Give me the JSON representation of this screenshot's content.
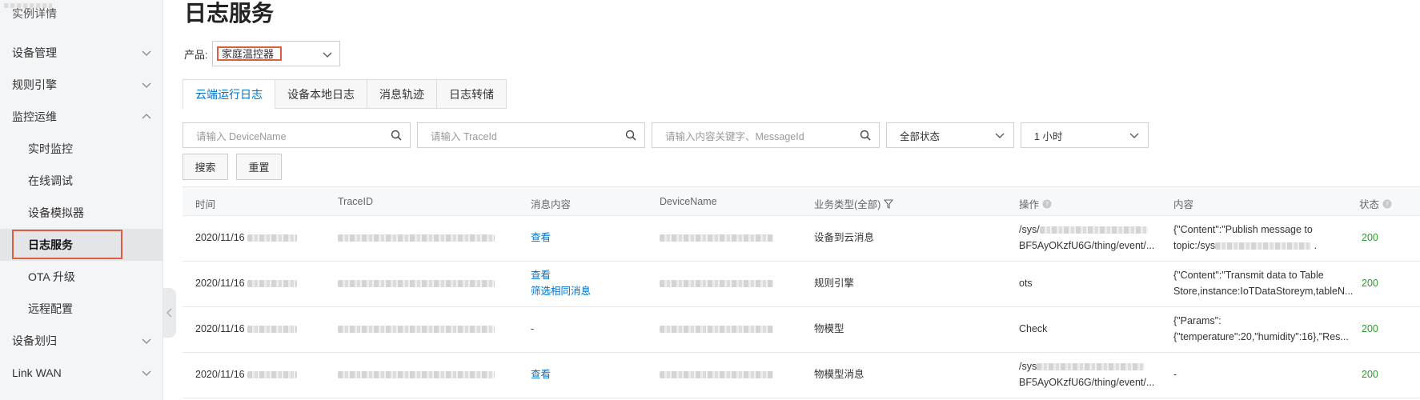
{
  "sidebar": {
    "top_item": "实例详情",
    "items": [
      {
        "label": "设备管理",
        "state": "collapsed"
      },
      {
        "label": "规则引擎",
        "state": "collapsed"
      },
      {
        "label": "监控运维",
        "state": "expanded"
      },
      {
        "label": "实时监控"
      },
      {
        "label": "在线调试"
      },
      {
        "label": "设备模拟器"
      },
      {
        "label": "日志服务",
        "active": true
      },
      {
        "label": "OTA 升级"
      },
      {
        "label": "远程配置"
      },
      {
        "label": "设备划归",
        "state": "collapsed"
      },
      {
        "label": "Link WAN",
        "state": "collapsed"
      }
    ]
  },
  "page": {
    "title": "日志服务",
    "product_label": "产品:",
    "product_value": "家庭温控器"
  },
  "tabs": [
    "云端运行日志",
    "设备本地日志",
    "消息轨迹",
    "日志转储"
  ],
  "filters": {
    "device_placeholder": "请输入 DeviceName",
    "trace_placeholder": "请输入 TraceId",
    "content_placeholder": "请输入内容关键字、MessageId",
    "status_value": "全部状态",
    "time_value": "1 小时",
    "search_label": "搜索",
    "reset_label": "重置"
  },
  "table": {
    "headers": [
      "时间",
      "TraceID",
      "消息内容",
      "DeviceName",
      "业务类型(全部)",
      "操作",
      "内容",
      "状态"
    ],
    "rows": [
      {
        "time": "2020/11/16",
        "message": [
          "查看"
        ],
        "biz": "设备到云消息",
        "op_1": "/sys/",
        "op_2": "BF5AyOKzfU6G/thing/event/...",
        "content_1": "{\"Content\":\"Publish message to",
        "content_2": "topic:/sys",
        "status": "200"
      },
      {
        "time": "2020/11/16",
        "message": [
          "查看",
          "筛选相同消息"
        ],
        "biz": "规则引擎",
        "op_1": "ots",
        "op_2": "",
        "content_1": "{\"Content\":\"Transmit data to Table",
        "content_2": "Store,instance:IoTDataStoreym,tableN...",
        "status": "200"
      },
      {
        "time": "2020/11/16",
        "message": [
          "-"
        ],
        "biz": "物模型",
        "op_1": "Check",
        "op_2": "",
        "content_1": "{\"Params\":",
        "content_2": "{\"temperature\":20,\"humidity\":16},\"Res...",
        "status": "200"
      },
      {
        "time": "2020/11/16",
        "message": [
          "查看"
        ],
        "biz": "物模型消息",
        "op_1": "/sys",
        "op_2": "BF5AyOKzfU6G/thing/event/...",
        "content_1": "-",
        "content_2": "",
        "status": "200"
      }
    ]
  },
  "colors": {
    "link": "#0070cc",
    "status_ok": "#2c9a2c",
    "highlight": "#e05d44"
  }
}
